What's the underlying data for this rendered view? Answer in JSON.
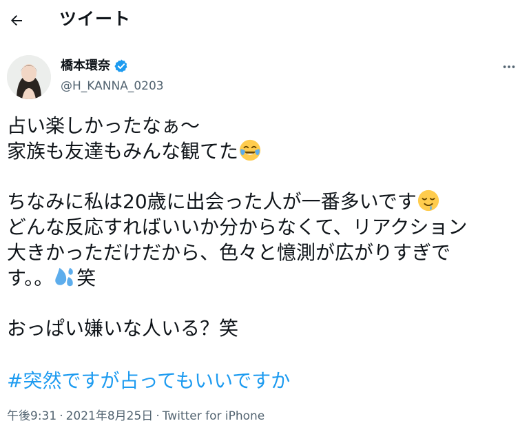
{
  "header": {
    "back_icon": "arrow-left-icon",
    "title": "ツイート"
  },
  "tweet": {
    "author": {
      "display_name": "橋本環奈",
      "handle": "@H_KANNA_0203",
      "verified_icon": "verified-badge-icon",
      "avatar": "avatar"
    },
    "more_icon": "more-horizontal-icon",
    "lines": [
      "占い楽しかったなぁ〜",
      "家族も友達もみんな観てた",
      "",
      "ちなみに私は20歳に出会った人が一番多いです",
      "どんな反応すればいいか分からなくて、リアクション",
      "大きかっただけだから、色々と憶測が広がりすぎで",
      "す。。",
      "笑",
      "",
      "おっぱい嫌いな人いる？笑"
    ],
    "emojis": {
      "line2": "face-with-tears-of-joy-emoji",
      "line4": "drooling-face-emoji",
      "line7": "sweat-droplets-emoji"
    },
    "hashtag": "#突然ですが占ってもいいですか",
    "time": "午後9:31",
    "date": "2021年8月25日",
    "separator": "·",
    "source": "Twitter for iPhone"
  },
  "colors": {
    "text": "#0f1419",
    "secondary": "#536471",
    "link": "#1d9bf0",
    "verified": "#1d9bf0"
  }
}
